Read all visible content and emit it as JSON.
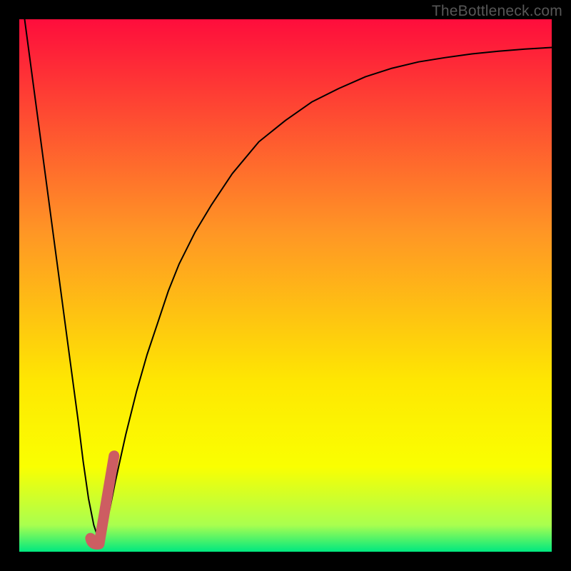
{
  "watermark": "TheBottleneck.com",
  "colors": {
    "frame": "#000000",
    "curve": "#000000",
    "marker": "#cd5d62",
    "gradient_top": "#fe0d3c",
    "gradient_mid1": "#ff9625",
    "gradient_mid2": "#fee702",
    "gradient_mid3": "#faff01",
    "gradient_band": "#a9ff4f",
    "gradient_bottom": "#00e880"
  },
  "chart_data": {
    "type": "line",
    "title": "",
    "xlabel": "",
    "ylabel": "",
    "xlim": [
      0,
      100
    ],
    "ylim": [
      0,
      100
    ],
    "series": [
      {
        "name": "bottleneck-curve",
        "x": [
          1.0,
          3.0,
          5.0,
          7.0,
          9.0,
          11.0,
          12.0,
          13.0,
          14.0,
          15.0,
          16.0,
          17.0,
          18.0,
          20.0,
          22.0,
          24.0,
          26.0,
          28.0,
          30.0,
          33.0,
          36.0,
          40.0,
          45.0,
          50.0,
          55.0,
          60.0,
          65.0,
          70.0,
          75.0,
          80.0,
          85.0,
          90.0,
          95.0,
          100.0
        ],
        "y": [
          100.0,
          85.0,
          70.0,
          55.0,
          40.0,
          25.0,
          17.0,
          10.0,
          5.0,
          2.0,
          4.0,
          8.0,
          13.0,
          22.0,
          30.0,
          37.0,
          43.0,
          49.0,
          54.0,
          60.0,
          65.0,
          71.0,
          77.0,
          81.0,
          84.5,
          87.0,
          89.2,
          90.8,
          92.0,
          92.8,
          93.5,
          94.0,
          94.4,
          94.7
        ]
      }
    ],
    "marker": {
      "name": "selection-marker",
      "xy_start": [
        15.0,
        2.0
      ],
      "xy_end": [
        17.8,
        18.0
      ]
    }
  }
}
